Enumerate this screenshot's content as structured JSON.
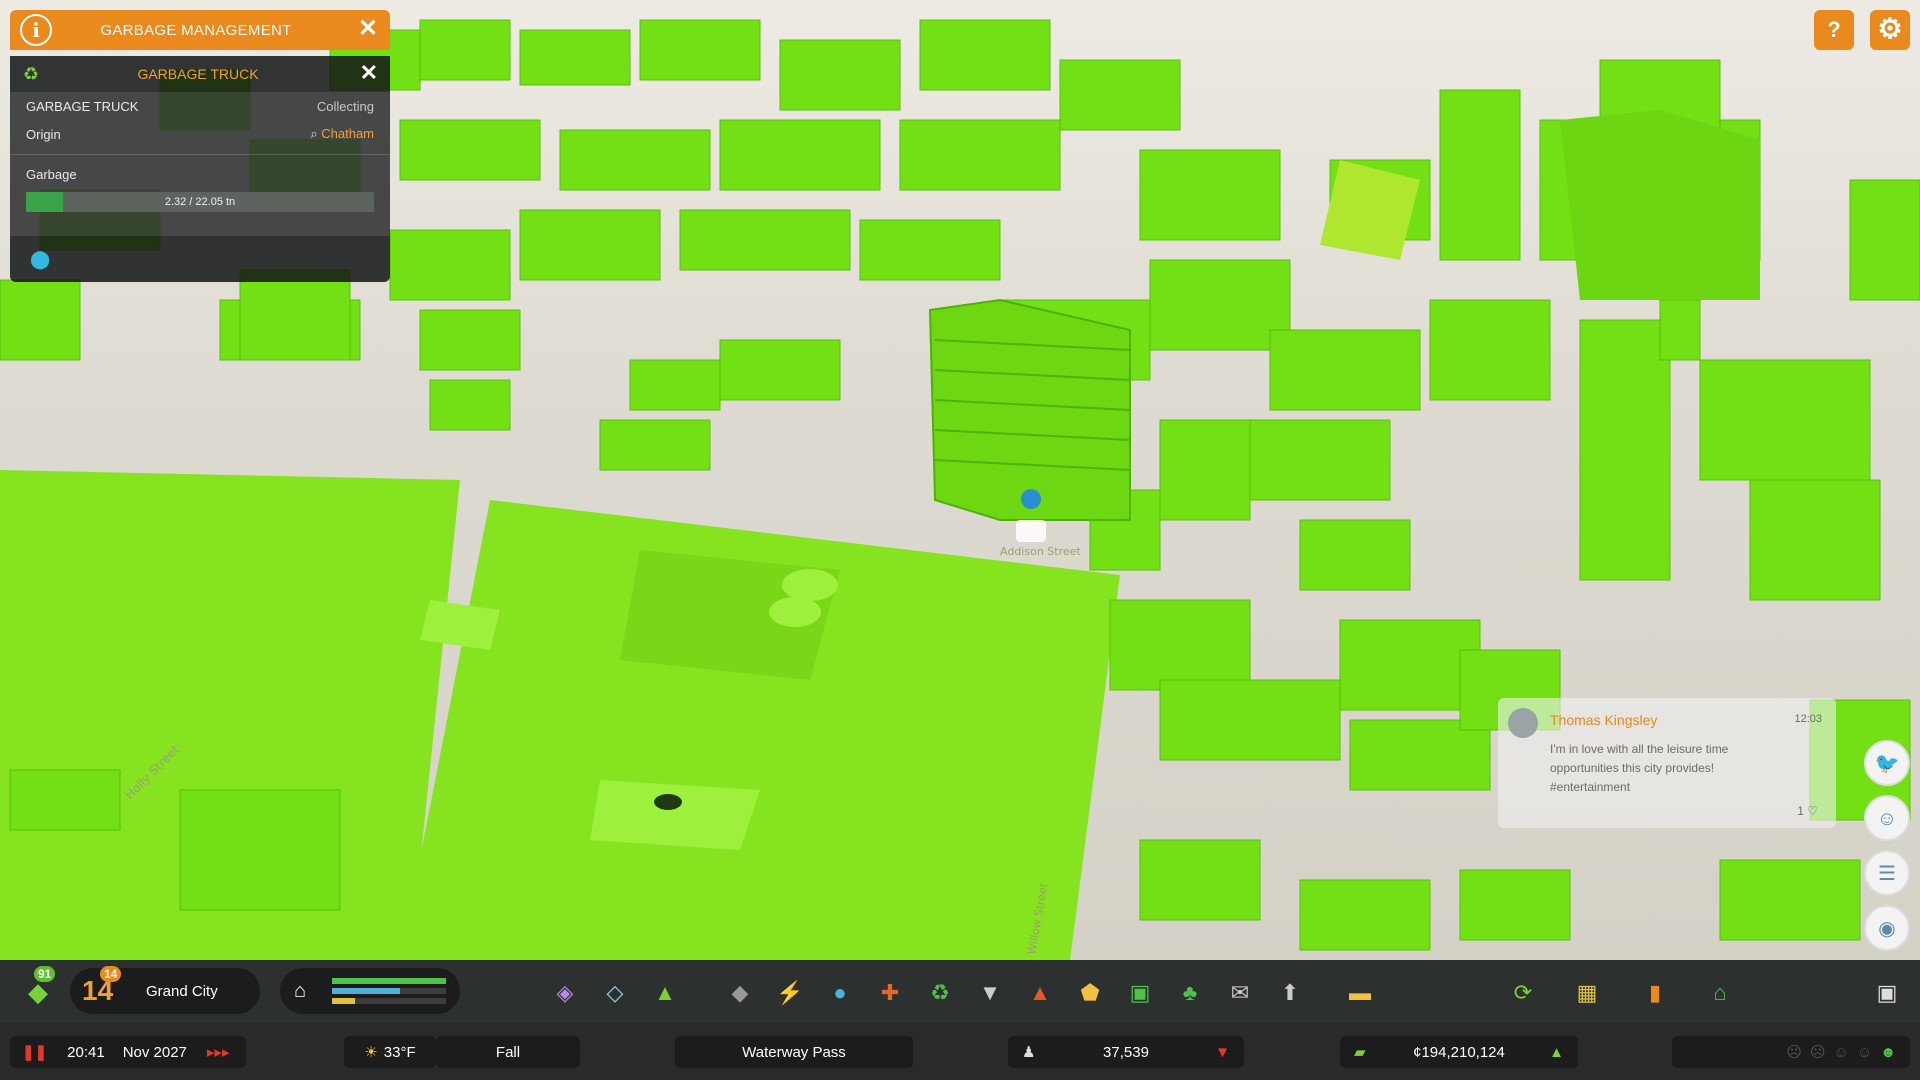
{
  "info_panel": {
    "header_title": "GARBAGE MANAGEMENT",
    "sub_title": "GARBAGE TRUCK",
    "vehicle_label": "GARBAGE TRUCK",
    "vehicle_status": "Collecting",
    "origin_label": "Origin",
    "origin_value": "Chatham",
    "garbage_label": "Garbage",
    "garbage_text": "2.32 / 22.05 tn",
    "garbage_fraction": 0.105
  },
  "map_labels": {
    "street_1": "Holly Street",
    "street_2": "Addison Street",
    "street_3": "Willow Street"
  },
  "chirp": {
    "author": "Thomas Kingsley",
    "time": "12:03",
    "message": "I'm in love with all the leisure time opportunities this city provides! #entertainment",
    "likes": "1"
  },
  "toolbar": {
    "milestone_count": "91",
    "level": "14",
    "level_badge": "14",
    "city_name": "Grand City",
    "tools": [
      "zoning-icon",
      "area-icon",
      "landscaping-icon",
      "roads-icon",
      "electricity-icon",
      "water-icon",
      "health-icon",
      "garbage-icon",
      "education-icon",
      "fire-icon",
      "police-icon",
      "transport-icon",
      "parks-icon",
      "communications-icon",
      "landmarks-icon",
      "bulldozer-icon"
    ]
  },
  "status": {
    "time": "20:41",
    "date": "Nov 2027",
    "temperature": "33°F",
    "season": "Fall",
    "map_name": "Waterway Pass",
    "population": "37,539",
    "money": "¢194,210,124"
  },
  "colors": {
    "accent": "#ea8a1e",
    "building_green": "#7ee71c",
    "ground_green": "#88e820",
    "progress_fill": "#3aa349"
  }
}
